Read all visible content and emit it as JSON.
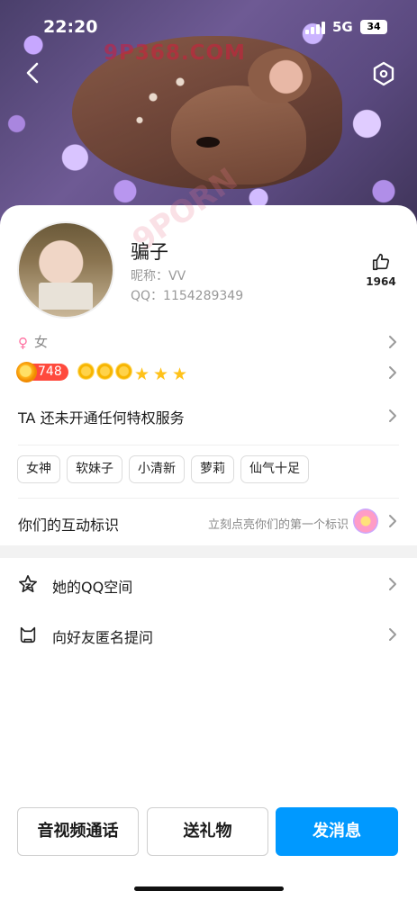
{
  "status_bar": {
    "time": "22:20",
    "network": "5G",
    "battery": "34"
  },
  "header": {
    "watermark": "9P368.COM"
  },
  "profile": {
    "name": "骗子",
    "nickname": "昵称：VV",
    "qq": "QQ：1154289349",
    "likes": "1964",
    "gender": "女",
    "level": "748",
    "card_watermark": "9PORN"
  },
  "privilege": {
    "text": "TA 还未开通任何特权服务"
  },
  "tags": [
    "女神",
    "软妹子",
    "小清新",
    "萝莉",
    "仙气十足"
  ],
  "interaction": {
    "label": "你们的互动标识",
    "hint": "立刻点亮你们的第一个标识"
  },
  "menu": {
    "qzone": "她的QQ空间",
    "anonymous": "向好友匿名提问"
  },
  "buttons": {
    "call": "音视频通话",
    "gift": "送礼物",
    "message": "发消息"
  },
  "colors": {
    "accent": "#0099ff",
    "level_badge": "#ff4a3d",
    "gender": "#ff6fa0"
  }
}
